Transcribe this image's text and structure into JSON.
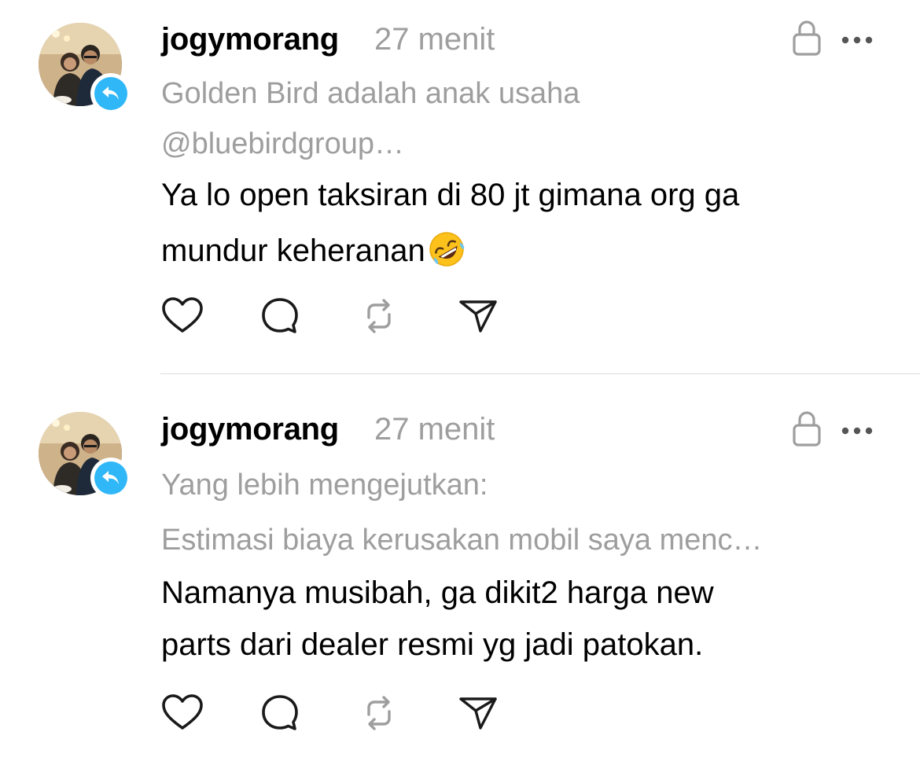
{
  "posts": [
    {
      "username": "jogymorang",
      "time": "27 menit",
      "quote_lines": [
        "Golden Bird adalah anak usaha",
        "@bluebirdgroup…"
      ],
      "body_lines": [
        "Ya lo open taksiran di 80 jt gimana org ga",
        "mundur keheranan"
      ],
      "emoji": "rolling-on-floor-laughing-emoji"
    },
    {
      "username": "jogymorang",
      "time": "27 menit",
      "quote_lines": [
        "Yang lebih mengejutkan:",
        "Estimasi biaya kerusakan mobil saya menc…"
      ],
      "body_lines": [
        "Namanya musibah, ga dikit2 harga new",
        "parts dari dealer resmi yg jadi patokan."
      ]
    }
  ],
  "colors": {
    "reply_badge": "#2fb7f7",
    "muted_text": "#9e9e9e",
    "icon_stroke": "#1a1a1a",
    "divider": "#dcdcdc"
  },
  "icons": {
    "reply": "reply-arrow-icon",
    "lock": "lock-icon",
    "more": "more-dots-icon",
    "like": "heart-icon",
    "comment": "comment-bubble-icon",
    "repost": "repost-icon",
    "share": "share-send-icon"
  }
}
